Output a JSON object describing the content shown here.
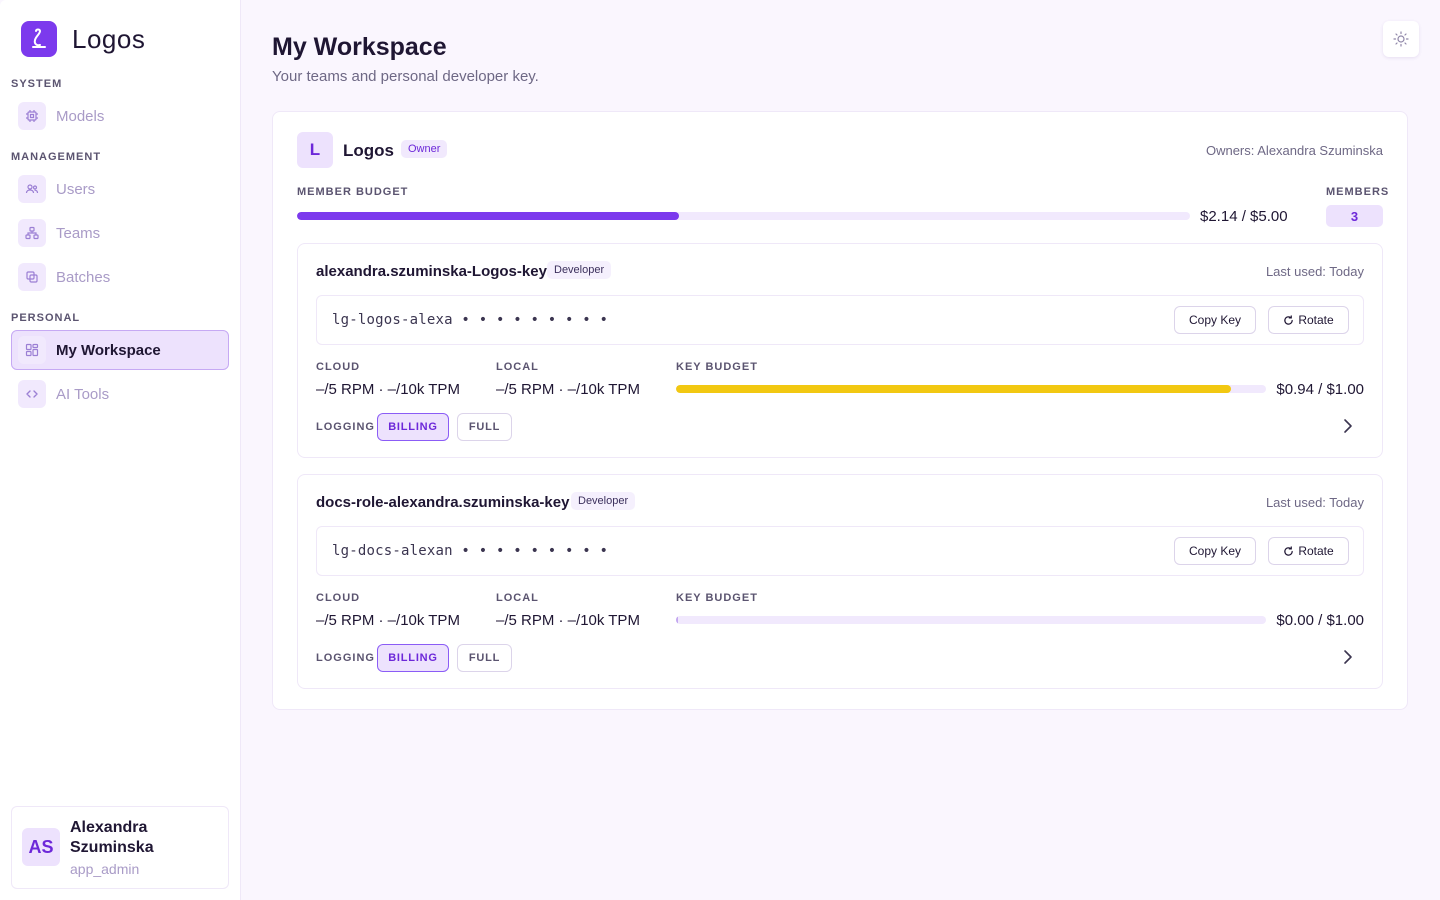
{
  "app": {
    "name": "Logos"
  },
  "sidebar": {
    "sections": [
      {
        "label": "SYSTEM"
      },
      {
        "label": "MANAGEMENT"
      },
      {
        "label": "PERSONAL"
      }
    ],
    "items": [
      {
        "label": "Models",
        "icon": "cpu-icon"
      },
      {
        "label": "Users",
        "icon": "users-icon"
      },
      {
        "label": "Teams",
        "icon": "teams-icon"
      },
      {
        "label": "Batches",
        "icon": "batches-icon"
      },
      {
        "label": "My Workspace",
        "icon": "grid-icon",
        "active": true
      },
      {
        "label": "AI Tools",
        "icon": "code-icon"
      }
    ],
    "user": {
      "initials": "AS",
      "name": "Alexandra Szuminska",
      "role": "app_admin"
    }
  },
  "header": {
    "title": "My Workspace",
    "subtitle": "Your teams and personal developer key."
  },
  "team": {
    "initial": "L",
    "name": "Logos",
    "role_badge": "Owner",
    "owners": "Owners: Alexandra Szuminska",
    "member_budget_label": "MEMBER BUDGET",
    "member_budget_text": "$2.14 / $5.00",
    "member_budget_fraction": 0.428,
    "members_label": "MEMBERS",
    "members_count": "3"
  },
  "keys": [
    {
      "name": "alexandra.szuminska-Logos-key",
      "badge": "Developer",
      "last_used": "Last used: Today",
      "key_value": "lg-logos-alexa • • • • • • • • •",
      "copy_label": "Copy Key",
      "rotate_label": "Rotate",
      "cloud_label": "CLOUD",
      "cloud_value": "–/5 RPM · –/10k TPM",
      "local_label": "LOCAL",
      "local_value": "–/5 RPM · –/10k TPM",
      "budget_label": "KEY BUDGET",
      "budget_text": "$0.94 / $1.00",
      "budget_fraction": 0.94,
      "budget_color": "#f2c811",
      "logging_label": "LOGGING",
      "logging_options": [
        "BILLING",
        "FULL"
      ],
      "logging_selected": "BILLING"
    },
    {
      "name": "docs-role-alexandra.szuminska-key",
      "badge": "Developer",
      "last_used": "Last used: Today",
      "key_value": "lg-docs-alexan • • • • • • • • •",
      "copy_label": "Copy Key",
      "rotate_label": "Rotate",
      "cloud_label": "CLOUD",
      "cloud_value": "–/5 RPM · –/10k TPM",
      "local_label": "LOCAL",
      "local_value": "–/5 RPM · –/10k TPM",
      "budget_label": "KEY BUDGET",
      "budget_text": "$0.00 / $1.00",
      "budget_fraction": 0.0,
      "budget_color": "#c4a8f0",
      "logging_label": "LOGGING",
      "logging_options": [
        "BILLING",
        "FULL"
      ],
      "logging_selected": "BILLING"
    }
  ],
  "colors": {
    "accent": "#7c3aed",
    "accent_soft": "#ede2fd",
    "member_bar": "#7c3aed"
  }
}
